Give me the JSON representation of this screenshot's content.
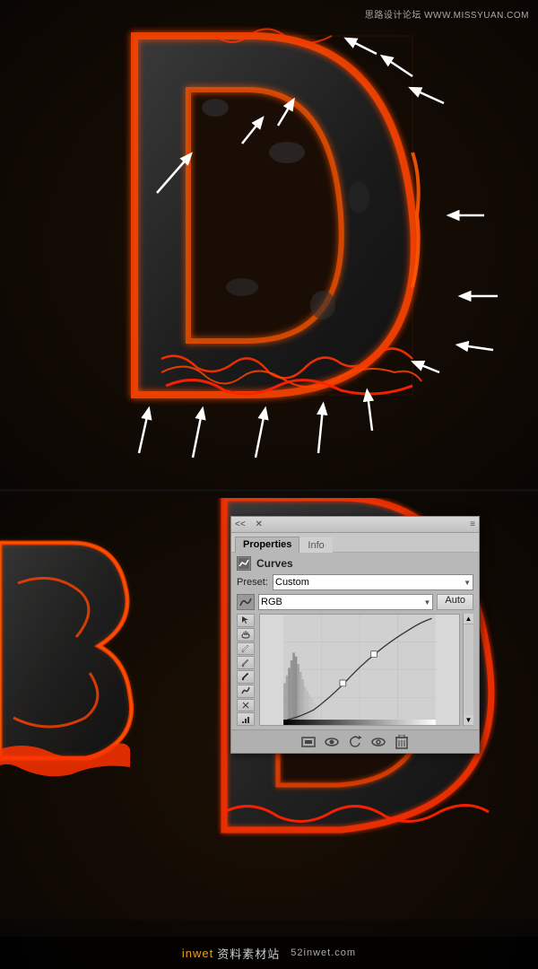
{
  "watermark_top": "思路设计论坛  WWW.MISSYUAN.COM",
  "watermark_bottom_prefix": "inwet",
  "watermark_bottom_site": "资料素材站",
  "watermark_bottom_url": "52inwet.com",
  "panel": {
    "title_left": "<<  X",
    "collapse_icon": "<<",
    "close_icon": "X",
    "menu_icon": "≡",
    "tabs": [
      {
        "label": "Properties",
        "active": true
      },
      {
        "label": "Info",
        "active": false
      }
    ],
    "section_title": "Curves",
    "preset_label": "Preset:",
    "preset_value": "Custom",
    "channel_value": "RGB",
    "auto_button": "Auto",
    "tools": [
      {
        "name": "pointer-tool",
        "symbol": "↗"
      },
      {
        "name": "hand-tool",
        "symbol": "✋"
      },
      {
        "name": "eyedropper-tool",
        "symbol": "✏"
      },
      {
        "name": "eyedropper2-tool",
        "symbol": "✏"
      },
      {
        "name": "eyedropper3-tool",
        "symbol": "✏"
      },
      {
        "name": "pencil-tool",
        "symbol": "∿"
      },
      {
        "name": "smooth-tool",
        "symbol": "—×"
      },
      {
        "name": "histogram-tool",
        "symbol": "▦"
      }
    ],
    "footer_icons": [
      {
        "name": "mask-icon",
        "symbol": "⬜"
      },
      {
        "name": "eye-icon",
        "symbol": "👁"
      },
      {
        "name": "reset-icon",
        "symbol": "↺"
      },
      {
        "name": "visibility-icon",
        "symbol": "👁"
      },
      {
        "name": "delete-icon",
        "symbol": "🗑"
      }
    ]
  }
}
